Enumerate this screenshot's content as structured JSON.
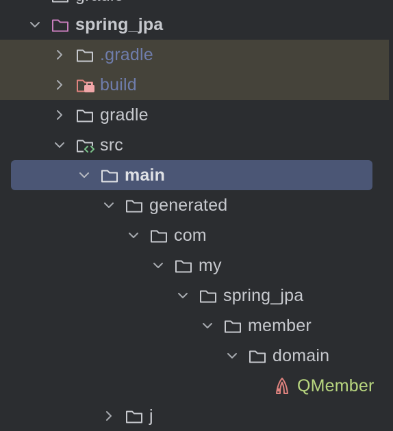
{
  "project_tree": {
    "items": [
      {
        "label": "gradle",
        "icon": "folder-icon",
        "expanded": false
      },
      {
        "label": "spring_jpa",
        "icon": "module-folder-icon",
        "expanded": true
      },
      {
        "label": ".gradle",
        "icon": "folder-icon",
        "expanded": false,
        "excluded": true
      },
      {
        "label": "build",
        "icon": "excluded-folder-icon",
        "expanded": false,
        "excluded": true
      },
      {
        "label": "gradle",
        "icon": "folder-icon",
        "expanded": false
      },
      {
        "label": "src",
        "icon": "source-folder-icon",
        "expanded": true
      },
      {
        "label": "main",
        "icon": "folder-icon",
        "expanded": true,
        "selected": true
      },
      {
        "label": "generated",
        "icon": "folder-icon",
        "expanded": true
      },
      {
        "label": "com",
        "icon": "folder-icon",
        "expanded": true
      },
      {
        "label": "my",
        "icon": "folder-icon",
        "expanded": true
      },
      {
        "label": "spring_jpa",
        "icon": "folder-icon",
        "expanded": true
      },
      {
        "label": "member",
        "icon": "folder-icon",
        "expanded": true
      },
      {
        "label": "domain",
        "icon": "folder-icon",
        "expanded": true
      },
      {
        "label": "QMember",
        "icon": "java-class-icon"
      },
      {
        "label": "j",
        "icon": "folder-icon",
        "expanded": false
      }
    ]
  },
  "colors": {
    "background": "#2b2d30",
    "selection": "#4b5675",
    "excluded_row": "#45433a",
    "module_icon": "#c77dbb",
    "excluded_icon": "#e0837f",
    "class_text": "#b8d67f",
    "muted_text": "#6f7dac"
  }
}
